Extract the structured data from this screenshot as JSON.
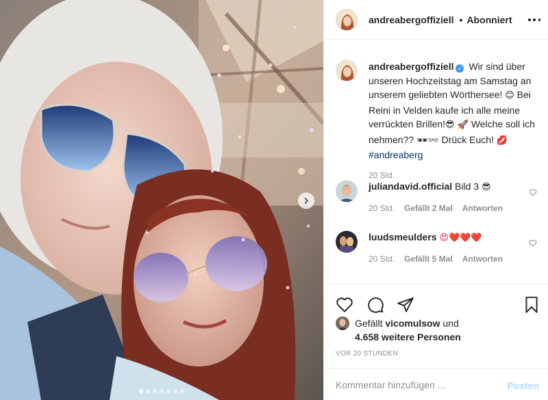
{
  "header": {
    "username": "andreabergoffiziell",
    "separator": "•",
    "follow_status": "Abonniert"
  },
  "caption": {
    "username": "andreabergoffiziell",
    "text_1": "Wir sind über unseren Hochzeitstag am Samstag an unserem geliebten Wörthersee!",
    "emoji_1": "😊",
    "text_2": "Bei Reini in Velden kaufe ich alle meine verrückten Brillen!",
    "emoji_2": "😎 🚀",
    "text_3": "Welche soll ich nehmen??",
    "emoji_3": "🕶👓",
    "text_4": "Drück Euch!",
    "emoji_4": "💋",
    "hashtag": "#andreaberg",
    "time": "20 Std."
  },
  "comments": [
    {
      "username": "juliandavid.official",
      "text": "Bild 3",
      "emoji": "😎",
      "time": "20 Std.",
      "likes": "Gefällt 2 Mal",
      "reply": "Antworten"
    },
    {
      "username": "luudsmeulders",
      "text": "",
      "emoji": "😍❤️❤️❤️",
      "time": "20 Std.",
      "likes": "Gefällt 5 Mal",
      "reply": "Antworten"
    }
  ],
  "likes": {
    "prefix": "Gefällt",
    "liker": "vicomulsow",
    "conjunction": "und",
    "others": "4.658 weitere Personen"
  },
  "post_date": "VOR 20 STUNDEN",
  "comment_box": {
    "placeholder": "Kommentar hinzufügen ...",
    "post_label": "Posten"
  },
  "carousel": {
    "total": 7,
    "active": 1
  },
  "colors": {
    "verified": "#3897f0",
    "hashtag": "#00376b",
    "post_disabled": "#b3dbff",
    "meta_grey": "#8e8e8e"
  },
  "icons": [
    "chevron-right-icon",
    "more-icon",
    "verified-icon",
    "heart-icon",
    "comment-icon",
    "share-icon",
    "bookmark-icon"
  ]
}
